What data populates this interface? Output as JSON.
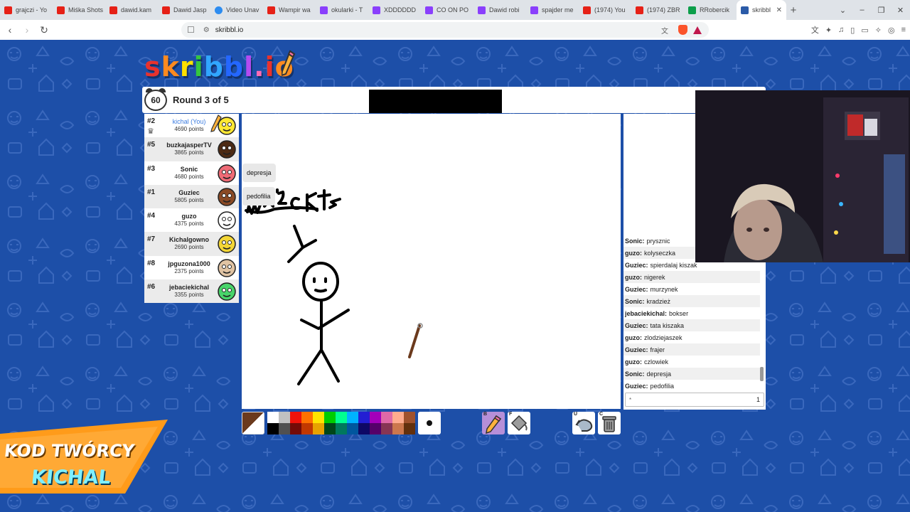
{
  "browser": {
    "tabs": [
      {
        "title": "grajczi - Yo",
        "favicon": "youtube-icon"
      },
      {
        "title": "Miśka Shots",
        "favicon": "youtube-icon"
      },
      {
        "title": "dawid.kam",
        "favicon": "youtube-icon"
      },
      {
        "title": "Dawid Jasp",
        "favicon": "youtube-icon"
      },
      {
        "title": "Video Unav",
        "favicon": "globe-icon"
      },
      {
        "title": "Wampir wa",
        "favicon": "youtube-icon"
      },
      {
        "title": "okularki - T",
        "favicon": "twitch-icon"
      },
      {
        "title": "XDDDDDD",
        "favicon": "twitch-icon"
      },
      {
        "title": "CO ON PO",
        "favicon": "twitch-icon"
      },
      {
        "title": "Dawid robi",
        "favicon": "twitch-icon"
      },
      {
        "title": "spajder me",
        "favicon": "twitch-icon"
      },
      {
        "title": "(1974) You",
        "favicon": "youtube-icon"
      },
      {
        "title": "(1974) ZBR",
        "favicon": "youtube-icon"
      },
      {
        "title": "RRobercik",
        "favicon": "rr-icon"
      },
      {
        "title": "skribbl",
        "favicon": "skribbl-icon",
        "active": true
      }
    ],
    "url": "skribbl.io",
    "new_tab": "+",
    "window_controls": [
      "⌄",
      "–",
      "❐",
      "✕"
    ]
  },
  "game": {
    "logo_text": "skribbl.io",
    "logo_colors": [
      "#e8322d",
      "#ff8a1f",
      "#ffe100",
      "#35c63f",
      "#31a6ff",
      "#2467ff",
      "#b44bf1",
      "#ff6bb5",
      "#e8322d",
      "#ff8a1f"
    ],
    "timer": "60",
    "round_text": "Round 3 of 5",
    "players": [
      {
        "rank": "#2",
        "name": "kichal (You)",
        "points": "4690 points",
        "is_me": true,
        "avatar_color": "#ffe833",
        "crown": true,
        "drawing": true
      },
      {
        "rank": "#5",
        "name": "buzkajasperTV",
        "points": "3865 points",
        "avatar_color": "#4d2b14"
      },
      {
        "rank": "#3",
        "name": "Sonic",
        "points": "4680 points",
        "avatar_color": "#ef6b76"
      },
      {
        "rank": "#1",
        "name": "Guziec",
        "points": "5805 points",
        "avatar_color": "#8a4a25"
      },
      {
        "rank": "#4",
        "name": "guzo",
        "points": "4375 points",
        "avatar_color": "#ffffff"
      },
      {
        "rank": "#7",
        "name": "Kichalgowno",
        "points": "2690 points",
        "avatar_color": "#f3d636"
      },
      {
        "rank": "#8",
        "name": "jpguzona1000",
        "points": "2375 points",
        "avatar_color": "#e0c3a3"
      },
      {
        "rank": "#6",
        "name": "jebaciekichal",
        "points": "3355 points",
        "avatar_color": "#48d46a"
      }
    ],
    "bubbles": [
      "depresja",
      "pedofilia"
    ],
    "chat": [
      {
        "user": "Sonic:",
        "text": "prysznic"
      },
      {
        "user": "guzo:",
        "text": "kolyseczka"
      },
      {
        "user": "Guziec:",
        "text": "spierdalaj kiszak"
      },
      {
        "user": "guzo:",
        "text": "nigerek"
      },
      {
        "user": "Guziec:",
        "text": "murzynek"
      },
      {
        "user": "Sonic:",
        "text": "kradzież"
      },
      {
        "user": "jebaciekichal:",
        "text": "bokser"
      },
      {
        "user": "Guziec:",
        "text": "tata kiszaka"
      },
      {
        "user": "guzo:",
        "text": "zlodziejaszek"
      },
      {
        "user": "Guziec:",
        "text": "frajer"
      },
      {
        "user": "guzo:",
        "text": "czlowiek"
      },
      {
        "user": "Sonic:",
        "text": "depresja"
      },
      {
        "user": "Guziec:",
        "text": "pedofilia"
      }
    ],
    "chat_input_value": "*",
    "chat_input_count": "1",
    "palette": [
      "#ffffff",
      "#c1c1c1",
      "#ef130b",
      "#ff7100",
      "#ffe400",
      "#00cc00",
      "#00ff91",
      "#00b2ff",
      "#231fd3",
      "#a300ba",
      "#df69a7",
      "#ffac8e",
      "#a0522d",
      "#000000",
      "#505050",
      "#740b07",
      "#c23800",
      "#e8a200",
      "#004619",
      "#00785d",
      "#00569e",
      "#0e0865",
      "#550069",
      "#873554",
      "#cc774d",
      "#63300d"
    ],
    "current_color": "#6b3a1d",
    "tools": [
      {
        "key": "B",
        "name": "pencil-tool",
        "selected": true
      },
      {
        "key": "F",
        "name": "fill-tool",
        "selected": false
      },
      {
        "key": "U",
        "name": "undo-tool",
        "selected": false
      },
      {
        "key": "C",
        "name": "clear-tool",
        "selected": false
      }
    ]
  },
  "promo": {
    "line1": "KOD TWÓRCY",
    "line2": "KICHAL"
  }
}
